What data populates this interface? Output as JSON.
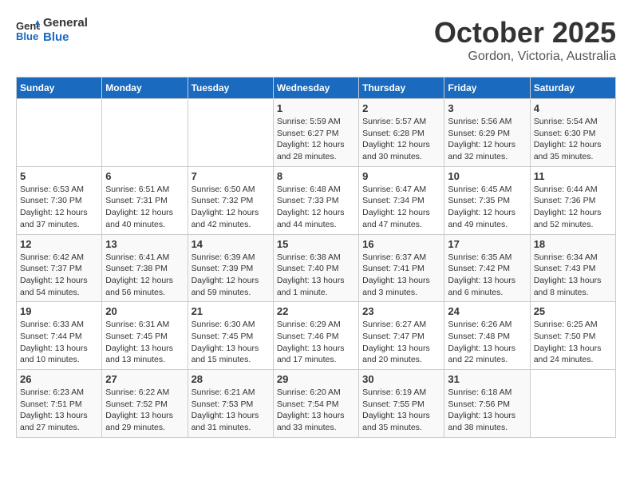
{
  "header": {
    "logo_line1": "General",
    "logo_line2": "Blue",
    "month": "October 2025",
    "location": "Gordon, Victoria, Australia"
  },
  "weekdays": [
    "Sunday",
    "Monday",
    "Tuesday",
    "Wednesday",
    "Thursday",
    "Friday",
    "Saturday"
  ],
  "weeks": [
    [
      {
        "day": "",
        "info": ""
      },
      {
        "day": "",
        "info": ""
      },
      {
        "day": "",
        "info": ""
      },
      {
        "day": "1",
        "info": "Sunrise: 5:59 AM\nSunset: 6:27 PM\nDaylight: 12 hours\nand 28 minutes."
      },
      {
        "day": "2",
        "info": "Sunrise: 5:57 AM\nSunset: 6:28 PM\nDaylight: 12 hours\nand 30 minutes."
      },
      {
        "day": "3",
        "info": "Sunrise: 5:56 AM\nSunset: 6:29 PM\nDaylight: 12 hours\nand 32 minutes."
      },
      {
        "day": "4",
        "info": "Sunrise: 5:54 AM\nSunset: 6:30 PM\nDaylight: 12 hours\nand 35 minutes."
      }
    ],
    [
      {
        "day": "5",
        "info": "Sunrise: 6:53 AM\nSunset: 7:30 PM\nDaylight: 12 hours\nand 37 minutes."
      },
      {
        "day": "6",
        "info": "Sunrise: 6:51 AM\nSunset: 7:31 PM\nDaylight: 12 hours\nand 40 minutes."
      },
      {
        "day": "7",
        "info": "Sunrise: 6:50 AM\nSunset: 7:32 PM\nDaylight: 12 hours\nand 42 minutes."
      },
      {
        "day": "8",
        "info": "Sunrise: 6:48 AM\nSunset: 7:33 PM\nDaylight: 12 hours\nand 44 minutes."
      },
      {
        "day": "9",
        "info": "Sunrise: 6:47 AM\nSunset: 7:34 PM\nDaylight: 12 hours\nand 47 minutes."
      },
      {
        "day": "10",
        "info": "Sunrise: 6:45 AM\nSunset: 7:35 PM\nDaylight: 12 hours\nand 49 minutes."
      },
      {
        "day": "11",
        "info": "Sunrise: 6:44 AM\nSunset: 7:36 PM\nDaylight: 12 hours\nand 52 minutes."
      }
    ],
    [
      {
        "day": "12",
        "info": "Sunrise: 6:42 AM\nSunset: 7:37 PM\nDaylight: 12 hours\nand 54 minutes."
      },
      {
        "day": "13",
        "info": "Sunrise: 6:41 AM\nSunset: 7:38 PM\nDaylight: 12 hours\nand 56 minutes."
      },
      {
        "day": "14",
        "info": "Sunrise: 6:39 AM\nSunset: 7:39 PM\nDaylight: 12 hours\nand 59 minutes."
      },
      {
        "day": "15",
        "info": "Sunrise: 6:38 AM\nSunset: 7:40 PM\nDaylight: 13 hours\nand 1 minute."
      },
      {
        "day": "16",
        "info": "Sunrise: 6:37 AM\nSunset: 7:41 PM\nDaylight: 13 hours\nand 3 minutes."
      },
      {
        "day": "17",
        "info": "Sunrise: 6:35 AM\nSunset: 7:42 PM\nDaylight: 13 hours\nand 6 minutes."
      },
      {
        "day": "18",
        "info": "Sunrise: 6:34 AM\nSunset: 7:43 PM\nDaylight: 13 hours\nand 8 minutes."
      }
    ],
    [
      {
        "day": "19",
        "info": "Sunrise: 6:33 AM\nSunset: 7:44 PM\nDaylight: 13 hours\nand 10 minutes."
      },
      {
        "day": "20",
        "info": "Sunrise: 6:31 AM\nSunset: 7:45 PM\nDaylight: 13 hours\nand 13 minutes."
      },
      {
        "day": "21",
        "info": "Sunrise: 6:30 AM\nSunset: 7:45 PM\nDaylight: 13 hours\nand 15 minutes."
      },
      {
        "day": "22",
        "info": "Sunrise: 6:29 AM\nSunset: 7:46 PM\nDaylight: 13 hours\nand 17 minutes."
      },
      {
        "day": "23",
        "info": "Sunrise: 6:27 AM\nSunset: 7:47 PM\nDaylight: 13 hours\nand 20 minutes."
      },
      {
        "day": "24",
        "info": "Sunrise: 6:26 AM\nSunset: 7:48 PM\nDaylight: 13 hours\nand 22 minutes."
      },
      {
        "day": "25",
        "info": "Sunrise: 6:25 AM\nSunset: 7:50 PM\nDaylight: 13 hours\nand 24 minutes."
      }
    ],
    [
      {
        "day": "26",
        "info": "Sunrise: 6:23 AM\nSunset: 7:51 PM\nDaylight: 13 hours\nand 27 minutes."
      },
      {
        "day": "27",
        "info": "Sunrise: 6:22 AM\nSunset: 7:52 PM\nDaylight: 13 hours\nand 29 minutes."
      },
      {
        "day": "28",
        "info": "Sunrise: 6:21 AM\nSunset: 7:53 PM\nDaylight: 13 hours\nand 31 minutes."
      },
      {
        "day": "29",
        "info": "Sunrise: 6:20 AM\nSunset: 7:54 PM\nDaylight: 13 hours\nand 33 minutes."
      },
      {
        "day": "30",
        "info": "Sunrise: 6:19 AM\nSunset: 7:55 PM\nDaylight: 13 hours\nand 35 minutes."
      },
      {
        "day": "31",
        "info": "Sunrise: 6:18 AM\nSunset: 7:56 PM\nDaylight: 13 hours\nand 38 minutes."
      },
      {
        "day": "",
        "info": ""
      }
    ]
  ]
}
